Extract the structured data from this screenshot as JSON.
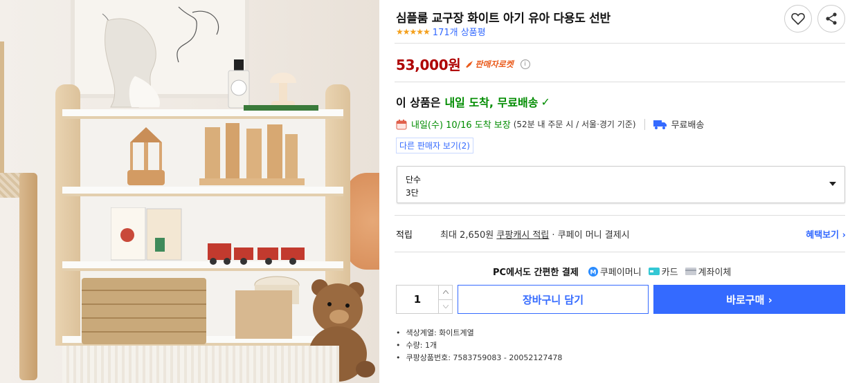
{
  "product": {
    "title": "심플룸 교구장 화이트 아기 유아 다용도 선반",
    "stars": "★★★★★",
    "review_count": "171개 상품평",
    "rating": 4.5
  },
  "price": {
    "amount": "53,000원",
    "badge": "판매자로켓",
    "info": "i"
  },
  "delivery": {
    "headline_prefix": "이 상품은",
    "headline_green": "내일 도착, 무료배송",
    "check": "✓",
    "eta_green": "내일(수) 10/16 도착 보장",
    "eta_note": "(52분  내 주문 시 / 서울·경기 기준)",
    "free_shipping": "무료배송",
    "other_sellers": "다른 판매자 보기(2)"
  },
  "option": {
    "label": "단수",
    "value": "3단"
  },
  "accumulation": {
    "label": "적립",
    "prefix": "최대 2,650원",
    "link": "쿠팡캐시 적립",
    "suffix": "· 쿠페이 머니 결제시",
    "benefit": "혜택보기 ›"
  },
  "payment": {
    "title": "PC에서도 간편한 결제",
    "methods": [
      "쿠페이머니",
      "카드",
      "계좌이체"
    ]
  },
  "purchase": {
    "quantity": "1",
    "cart_label": "장바구니 담기",
    "buy_label": "바로구매 ›"
  },
  "specs": [
    "색상계열: 화이트계열",
    "수량: 1개",
    "쿠팡상품번호: 7583759083 - 20052127478"
  ],
  "colors": {
    "accent": "#346aff",
    "price": "#ae0000",
    "green": "#008c00",
    "star": "#f4a01c"
  }
}
